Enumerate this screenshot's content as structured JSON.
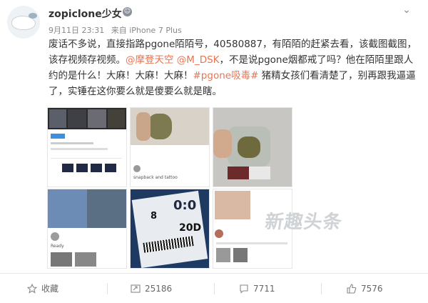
{
  "post": {
    "username": "zopiclone少女",
    "vip_badge": "☺",
    "date": "9月11日 23:31",
    "source": "来自 iPhone 7 Plus",
    "text": {
      "part1": "废话不多说，直接指路pgone陌陌号，40580887，有陌陌的赶紧去看，该截图截图，该存视频存视频。",
      "mention1": "@摩登天空",
      "mention2": "@M_DSK",
      "part2": "，不是说pgone烟都戒了吗？他在陌陌里跟人约的是什么！大麻！大麻！大麻！",
      "tag": "#pgone吸毒#",
      "part3": " 猪精女孩们看清楚了，别再跟我逼逼了，实锤在这你要么就是傻要么就是瞎。"
    }
  },
  "images": {
    "t4_caption": "Ready",
    "t5_tag_number": "8",
    "t5_code": "20D",
    "t5_letters": "0:0",
    "t1_caption": "snapback and tattoo",
    "watermark": "新趣头条"
  },
  "actions": {
    "favorite_label": "收藏",
    "repost_count": "25186",
    "comment_count": "7711",
    "like_count": "7576"
  },
  "colors": {
    "accent": "#eb7350",
    "muted": "#888888"
  },
  "icons": {
    "menu": "chevron-down-icon",
    "favorite": "star-icon",
    "repost": "repost-icon",
    "comment": "comment-icon",
    "like": "thumbs-up-icon"
  }
}
